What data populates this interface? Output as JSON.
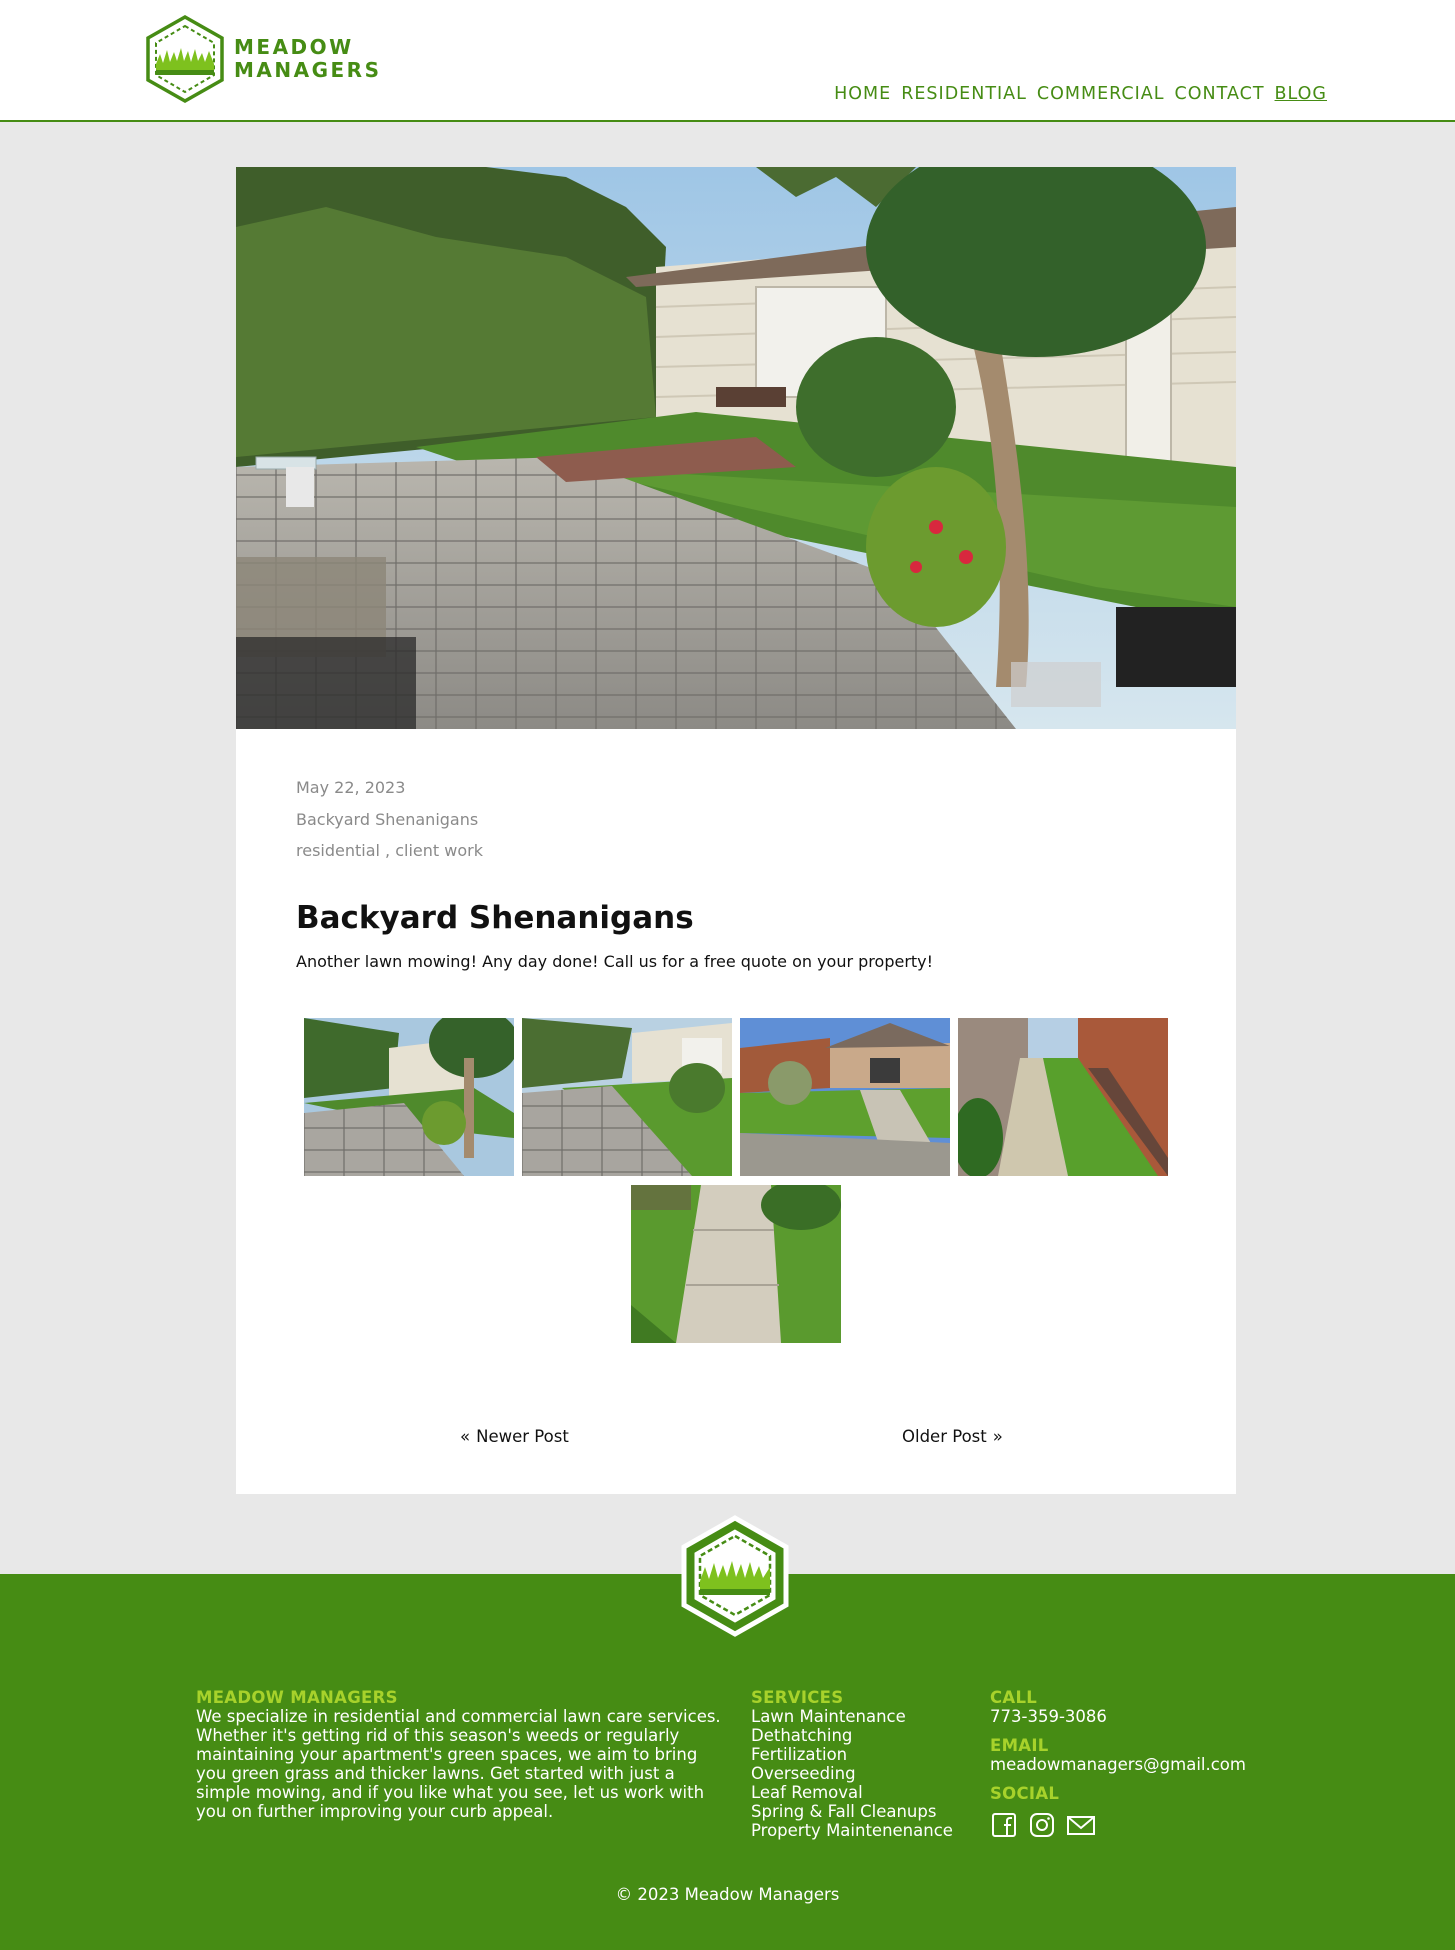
{
  "brand": {
    "line1": "MEADOW",
    "line2": "MANAGERS"
  },
  "nav": [
    {
      "label": "HOME"
    },
    {
      "label": "RESIDENTIAL"
    },
    {
      "label": "COMMERCIAL"
    },
    {
      "label": "CONTACT"
    },
    {
      "label": "BLOG",
      "active": true
    }
  ],
  "post": {
    "date": "May 22, 2023",
    "author_line": "Backyard Shenanigans",
    "tags": "residential , client work",
    "title": "Backyard Shenanigans",
    "body": "Another lawn mowing! Any day done! Call us for a free quote on your property!",
    "gallery": [
      "backyard-patio",
      "backyard-walkway",
      "front-yard",
      "side-yard",
      "front-sidewalk"
    ]
  },
  "pager": {
    "newer": "Newer Post",
    "older": "Older Post"
  },
  "footer": {
    "about_heading": "MEADOW MANAGERS",
    "about_text": "We specialize in residential and commercial lawn care services. Whether it's getting rid of this season's weeds or regularly maintaining your apartment's green spaces, we aim to bring you green grass and thicker lawns. Get started with just a simple mowing, and if you like what you see, let us work with you on further improving your curb appeal.",
    "services_heading": "SERVICES",
    "services": [
      "Lawn Maintenance",
      "Dethatching",
      "Fertilization",
      "Overseeding",
      "Leaf Removal",
      "Spring & Fall Cleanups",
      "Property Maintenenance"
    ],
    "call_heading": "CALL",
    "phone": "773-359-3086",
    "email_heading": "EMAIL",
    "email": "meadowmanagers@gmail.com",
    "social_heading": "SOCIAL",
    "social_icons": [
      "facebook-icon",
      "instagram-icon",
      "mail-icon"
    ],
    "copyright": "© 2023 Meadow Managers"
  },
  "colors": {
    "brand_green": "#468c14",
    "accent_lime": "#a7d22b",
    "page_bg": "#e8e8e8"
  }
}
